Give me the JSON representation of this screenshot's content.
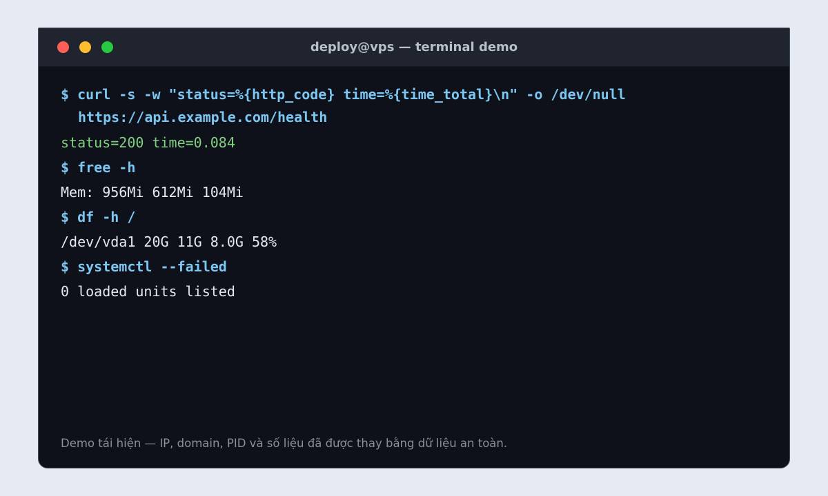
{
  "window": {
    "title": "deploy@vps — terminal demo",
    "traffic_lights": [
      "close",
      "minimize",
      "maximize"
    ],
    "colors": {
      "close": "#fd5f57",
      "minimize": "#febc2e",
      "maximize": "#28c840",
      "background": "#0e1119",
      "command": "#7cc6f2",
      "output": "#e6e9ef",
      "success_output": "#7fd17f"
    }
  },
  "terminal": {
    "lines": [
      {
        "type": "command",
        "text": "$ curl -s -w \"status=%{http_code} time=%{time_total}\\n\" -o /dev/null"
      },
      {
        "type": "command-continuation",
        "text": "https://api.example.com/health"
      },
      {
        "type": "output-success",
        "text": "status=200 time=0.084"
      },
      {
        "type": "command",
        "text": "$ free -h"
      },
      {
        "type": "output",
        "text": "Mem: 956Mi 612Mi 104Mi"
      },
      {
        "type": "command",
        "text": "$ df -h /"
      },
      {
        "type": "output",
        "text": "/dev/vda1 20G 11G 8.0G 58%"
      },
      {
        "type": "command",
        "text": "$ systemctl --failed"
      },
      {
        "type": "output",
        "text": "0 loaded units listed"
      }
    ]
  },
  "footer": {
    "note": "Demo tái hiện — IP, domain, PID và số liệu đã được thay bằng dữ liệu an toàn."
  }
}
